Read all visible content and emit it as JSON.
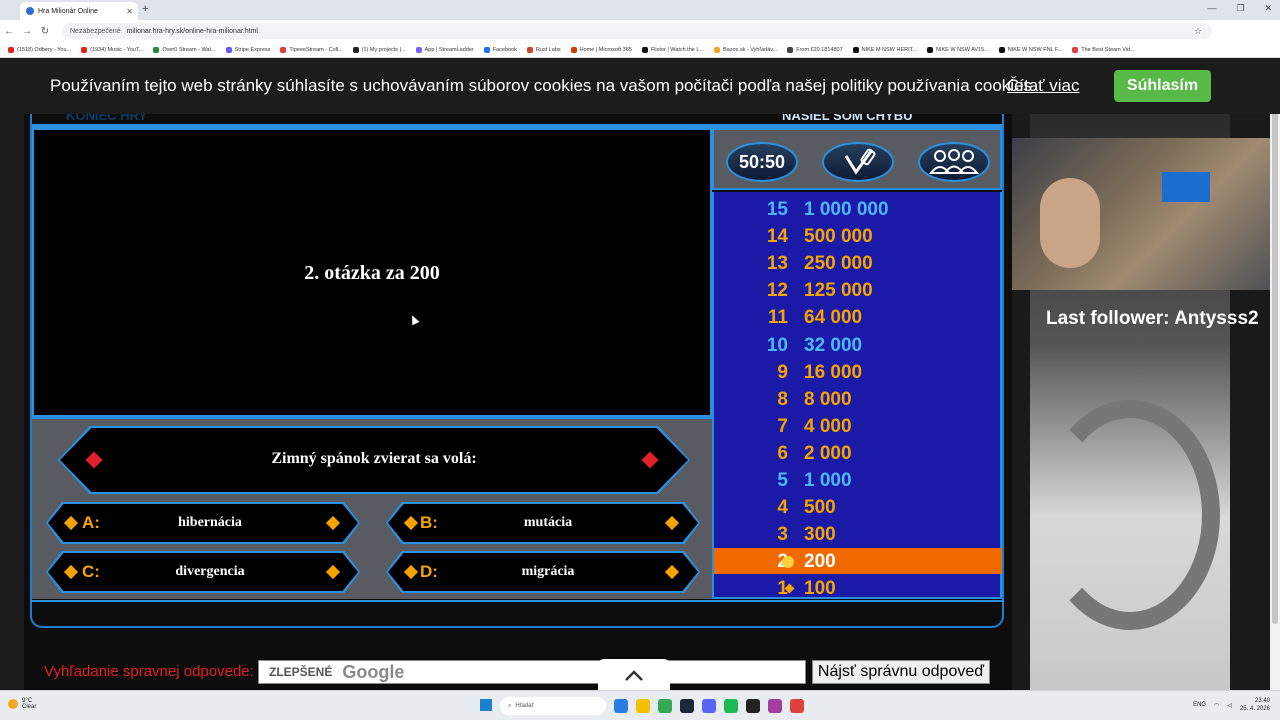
{
  "browser": {
    "tab_title": "Hra Milionár Online",
    "new_tab": "+",
    "address_insecure": "Nezabezpečené",
    "url": "milionar.hra-hry.sk/online-hra-milionar.html",
    "bookmarks": [
      {
        "label": "(1518) Odbery - You...",
        "color": "#e62117"
      },
      {
        "label": "(1934) Music - YouT...",
        "color": "#e62117"
      },
      {
        "label": "Over0 Stream - Wat...",
        "color": "#2a8a3a"
      },
      {
        "label": "Stripe Express",
        "color": "#635bff"
      },
      {
        "label": "TipeeeStream - Coll...",
        "color": "#e0413a"
      },
      {
        "label": "(1) My projects |...",
        "color": "#222222"
      },
      {
        "label": "App | StreamLadder",
        "color": "#7b61ff"
      },
      {
        "label": "Facebook",
        "color": "#1877f2"
      },
      {
        "label": "Rust Labs",
        "color": "#ce412b"
      },
      {
        "label": "Home | Microsoft 365",
        "color": "#d83b01"
      },
      {
        "label": "Flixtor | Watch the L...",
        "color": "#111111"
      },
      {
        "label": "Bazos.sk - Vyhľadáv...",
        "color": "#f2a623"
      },
      {
        "label": "From €20.1814807",
        "color": "#444444"
      },
      {
        "label": "NIKE M NSW HERIT...",
        "color": "#111111"
      },
      {
        "label": "NIKE W NSW AV15...",
        "color": "#111111"
      },
      {
        "label": "NIKE W NSW FNL F...",
        "color": "#111111"
      },
      {
        "label": "The Best Steam Vid...",
        "color": "#e0413a"
      }
    ]
  },
  "cookie_bar": {
    "text": "Používaním tejto web stránky súhlasíte s uchovávaním súborov cookies na vašom počítači podľa našej politiky používania cookies.",
    "link": "Čítať viac",
    "button": "Súhlasím"
  },
  "game": {
    "koniec_label": "KONIEC HRY",
    "nasiel_label": "NAŠIEL SOM CHYBU",
    "question_title": "2. otázka za 200",
    "question": "Zimný spánok zvierat sa volá:",
    "answers": [
      {
        "letter": "A:",
        "text": "hibernácia"
      },
      {
        "letter": "B:",
        "text": "mutácia"
      },
      {
        "letter": "C:",
        "text": "divergencia"
      },
      {
        "letter": "D:",
        "text": "migrácia"
      }
    ],
    "lifelines": {
      "fifty": "50:50",
      "phone": "phone-icon",
      "audience": "audience-icon"
    },
    "ladder": [
      {
        "num": "15",
        "amount": "1 000 000",
        "style": "blue"
      },
      {
        "num": "14",
        "amount": "500 000",
        "style": "orange"
      },
      {
        "num": "13",
        "amount": "250 000",
        "style": "orange"
      },
      {
        "num": "12",
        "amount": "125 000",
        "style": "orange"
      },
      {
        "num": "11",
        "amount": "64 000",
        "style": "orange"
      },
      {
        "num": "10",
        "amount": "32 000",
        "style": "blue"
      },
      {
        "num": "9",
        "amount": "16 000",
        "style": "orange"
      },
      {
        "num": "8",
        "amount": "8 000",
        "style": "orange"
      },
      {
        "num": "7",
        "amount": "4 000",
        "style": "orange"
      },
      {
        "num": "6",
        "amount": "2 000",
        "style": "orange"
      },
      {
        "num": "5",
        "amount": "1 000",
        "style": "blue"
      },
      {
        "num": "4",
        "amount": "500",
        "style": "orange"
      },
      {
        "num": "3",
        "amount": "300",
        "style": "orange"
      },
      {
        "num": "2",
        "amount": "200",
        "style": "current"
      },
      {
        "num": "1",
        "amount": "100",
        "style": "passed"
      }
    ]
  },
  "search": {
    "label": "Vyhľadanie spravnej odpovede:",
    "badge": "ZLEPŠENÉ",
    "brand": "Google",
    "button": "Nájsť správnu odpoveď",
    "scroll_top": "^"
  },
  "stream": {
    "follower": "Last follower: Antysss2"
  },
  "taskbar": {
    "temp": "9°C",
    "condition": "Clear",
    "search": "Hľadať",
    "lang": "ENG",
    "time": "23:40",
    "date": "25. 4. 2026",
    "apps": [
      "#2a7de1",
      "#f2c200",
      "#34a853",
      "#1b2838",
      "#5865f2",
      "#1db954",
      "#222222",
      "#a33ea1",
      "#e0413a"
    ]
  }
}
